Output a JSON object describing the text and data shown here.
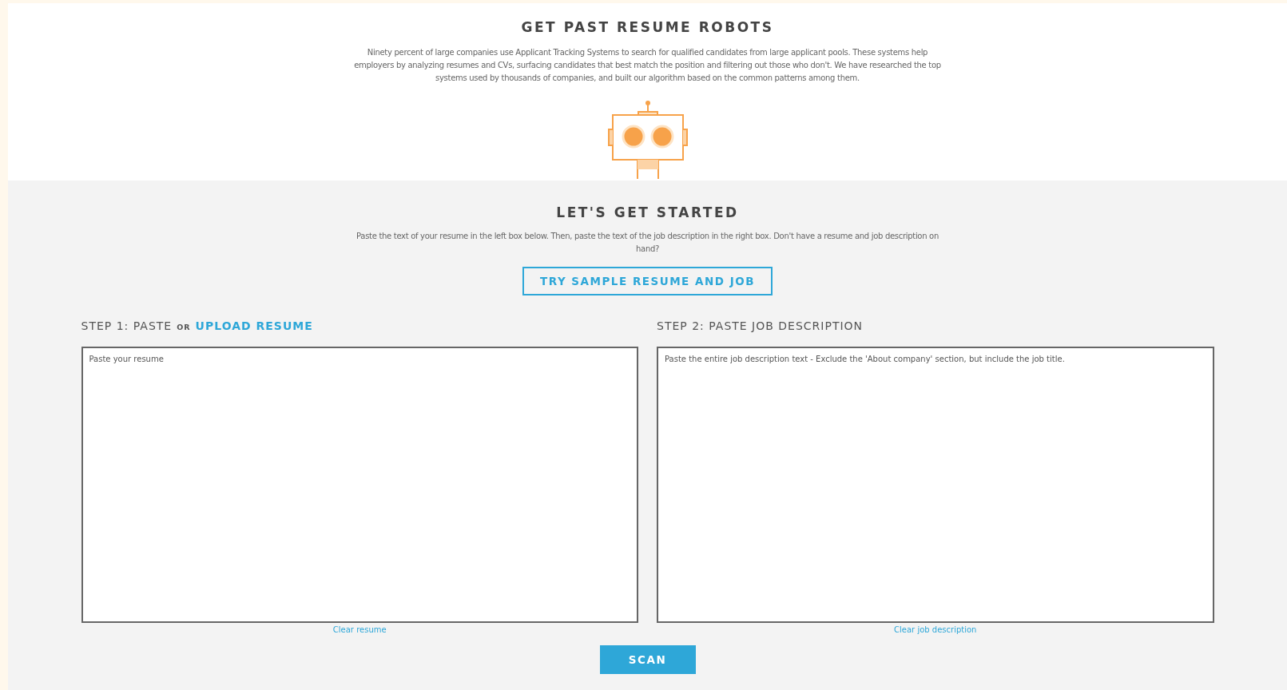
{
  "intro": {
    "title": "GET PAST RESUME ROBOTS",
    "text": "Ninety percent of large companies use Applicant Tracking Systems to search for qualified candidates from large applicant pools. These systems help employers by analyzing resumes and CVs, surfacing candidates that best match the position and filtering out those who don't. We have researched the top systems used by thousands of companies, and built our algorithm based on the common patterns among them."
  },
  "start": {
    "title": "LET'S GET STARTED",
    "text": "Paste the text of your resume in the left box below. Then, paste the text of the job description in the right box. Don't have a resume and job description on hand?",
    "sample_button": "TRY SAMPLE RESUME AND JOB"
  },
  "steps": [
    {
      "label": "STEP 1: PASTE",
      "or": "OR",
      "link": "UPLOAD RESUME",
      "placeholder": "Paste your resume",
      "clear": "Clear resume"
    },
    {
      "label": "STEP 2: PASTE JOB DESCRIPTION",
      "placeholder": "Paste the entire job description text - Exclude the 'About company' section, but include the job title.",
      "clear": "Clear job description"
    }
  ],
  "scan_button": "SCAN"
}
